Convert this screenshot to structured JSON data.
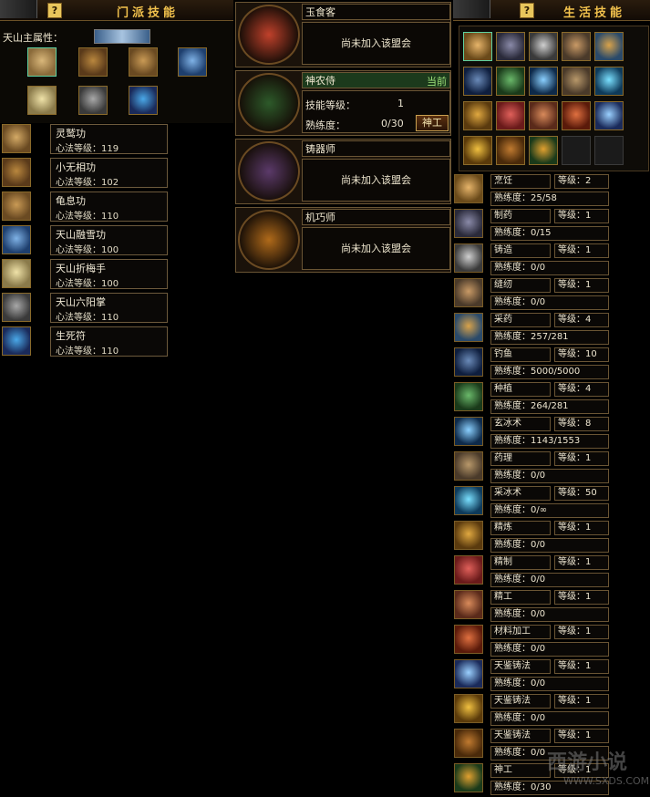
{
  "sect_panel": {
    "title": "门派技能",
    "help": "?",
    "main_attribute_label": "天山主属性：",
    "attribute_icons": [
      "scroll-tan-icon",
      "books-icon",
      "scroll-open-icon",
      "blue-book-icon",
      "book-page-icon",
      "scroll-gray-icon",
      "rune-blue-icon"
    ],
    "skills": [
      {
        "name": "灵鹫功",
        "level": "心法等级：119",
        "icon": "scroll-icon"
      },
      {
        "name": "小无相功",
        "level": "心法等级：102",
        "icon": "books-icon"
      },
      {
        "name": "龟息功",
        "level": "心法等级：110",
        "icon": "scroll-open-icon"
      },
      {
        "name": "天山融雪功",
        "level": "心法等级：100",
        "icon": "blue-book-icon"
      },
      {
        "name": "天山折梅手",
        "level": "心法等级：100",
        "icon": "book-page-icon"
      },
      {
        "name": "天山六阳掌",
        "level": "心法等级：110",
        "icon": "scroll-gray-icon"
      },
      {
        "name": "生死符",
        "level": "心法等级：110",
        "icon": "rune-blue-icon"
      }
    ]
  },
  "alliance_panel": {
    "alliances": [
      {
        "name": "玉食客",
        "message": "尚未加入该盟会",
        "emblem": "phoenix-emblem-icon",
        "color": "#c0412b"
      },
      {
        "name": "神农侍",
        "current": "当前",
        "skill_level_label": "技能等级：",
        "skill_level": "1",
        "proficiency_label": "熟练度：",
        "proficiency": "0/30",
        "button": "神工",
        "emblem": "yin-yang-emblem-icon",
        "color": "#2d5a2a"
      },
      {
        "name": "铸器师",
        "message": "尚未加入该盟会",
        "emblem": "forge-emblem-icon",
        "color": "#5b3a6a"
      },
      {
        "name": "机巧师",
        "message": "尚未加入该盟会",
        "emblem": "gear-emblem-icon",
        "color": "#b06a1a"
      }
    ]
  },
  "life_panel": {
    "title": "生活技能",
    "help": "?",
    "grid_icons": [
      "food-icon",
      "cauldron-icon",
      "anvil-icon",
      "needle-icon",
      "herb-icon",
      "fishing-icon",
      "sprout-icon",
      "ice-icon",
      "mortar-icon",
      "ice-crystal-icon",
      "chest-icon",
      "meat-icon",
      "hand-icon",
      "ore-icon",
      "lightning-icon",
      "chest-gold-icon",
      "chest-brown-icon",
      "orbs-icon",
      "empty",
      "empty"
    ],
    "skills": [
      {
        "name": "烹饪",
        "level": "等级：2",
        "proficiency": "熟练度：25/58",
        "icon": "food-icon"
      },
      {
        "name": "制药",
        "level": "等级：1",
        "proficiency": "熟练度：0/15",
        "icon": "cauldron-icon"
      },
      {
        "name": "铸造",
        "level": "等级：1",
        "proficiency": "熟练度：0/0",
        "icon": "anvil-icon"
      },
      {
        "name": "缝纫",
        "level": "等级：1",
        "proficiency": "熟练度：0/0",
        "icon": "needle-icon"
      },
      {
        "name": "采药",
        "level": "等级：4",
        "proficiency": "熟练度：257/281",
        "icon": "herb-icon"
      },
      {
        "name": "钓鱼",
        "level": "等级：10",
        "proficiency": "熟练度：5000/5000",
        "icon": "fishing-icon"
      },
      {
        "name": "种植",
        "level": "等级：4",
        "proficiency": "熟练度：264/281",
        "icon": "sprout-icon"
      },
      {
        "name": "玄冰术",
        "level": "等级：8",
        "proficiency": "熟练度：1143/1553",
        "icon": "ice-icon"
      },
      {
        "name": "药理",
        "level": "等级：1",
        "proficiency": "熟练度：0/0",
        "icon": "mortar-icon"
      },
      {
        "name": "采冰术",
        "level": "等级：50",
        "proficiency": "熟练度：0/∞",
        "icon": "ice-crystal-icon"
      },
      {
        "name": "精炼",
        "level": "等级：1",
        "proficiency": "熟练度：0/0",
        "icon": "chest-icon"
      },
      {
        "name": "精制",
        "level": "等级：1",
        "proficiency": "熟练度：0/0",
        "icon": "meat-icon"
      },
      {
        "name": "精工",
        "level": "等级：1",
        "proficiency": "熟练度：0/0",
        "icon": "hand-icon"
      },
      {
        "name": "材料加工",
        "level": "等级：1",
        "proficiency": "熟练度：0/0",
        "icon": "ore-icon"
      },
      {
        "name": "天鉴铸法",
        "level": "等级：1",
        "proficiency": "熟练度：0/0",
        "icon": "lightning-icon"
      },
      {
        "name": "天鉴铸法",
        "level": "等级：1",
        "proficiency": "熟练度：0/0",
        "icon": "chest-gold-icon"
      },
      {
        "name": "天鉴铸法",
        "level": "等级：1",
        "proficiency": "熟练度：0/0",
        "icon": "chest-brown-icon"
      },
      {
        "name": "神工",
        "level": "等级：1",
        "proficiency": "熟练度：0/30",
        "icon": "orbs-icon"
      }
    ]
  },
  "watermark": {
    "text": "西游小说",
    "site": "WWW.SXDS.COM"
  }
}
